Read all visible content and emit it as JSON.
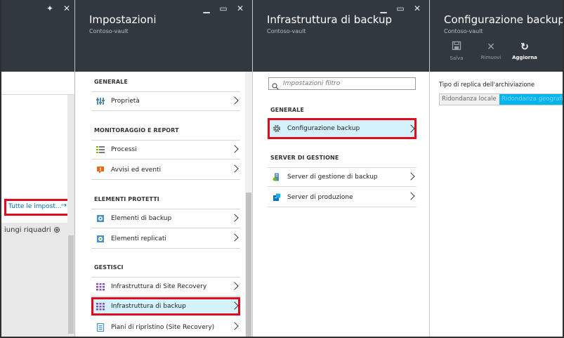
{
  "panel1": {
    "link_text": "Tutte le impost...",
    "arrow": "→",
    "add_tiles_text": "iungi riquadri",
    "add_icon": "⊕"
  },
  "panel2": {
    "title": "Impostazioni",
    "subtitle": "Contoso-vault",
    "sections": {
      "generale": "GENERALE",
      "monitoraggio": "MONITORAGGIO E REPORT",
      "elementi": "ELEMENTI PROTETTI",
      "gestisci": "GESTISCI"
    },
    "items": {
      "proprieta": "Proprietà",
      "processi": "Processi",
      "avvisi": "Avvisi ed eventi",
      "elementi_backup": "Elementi di backup",
      "elementi_replicati": "Elementi replicati",
      "infra_sr": "Infrastruttura di Site Recovery",
      "infra_backup": "Infrastruttura di backup",
      "piani": "Piani di ripristino (Site Recovery)"
    }
  },
  "panel3": {
    "title": "Infrastruttura di backup",
    "subtitle": "Contoso-vault",
    "filter_placeholder": "Impostazioni filtro",
    "sections": {
      "generale": "GENERALE",
      "server": "SERVER DI GESTIONE"
    },
    "items": {
      "config": "Configurazione backup",
      "server_backup": "Server di gestione di backup",
      "server_prod": "Server di produzione"
    }
  },
  "panel4": {
    "title": "Configurazione backup",
    "subtitle": "Contoso-vault",
    "toolbar": {
      "save": "Salva",
      "remove": "Rimuovi",
      "refresh": "Aggiorna"
    },
    "replica_label": "Tipo di replica dell'archiviazione",
    "options": [
      "Ridondanza locale",
      "Ridondanza geografica"
    ]
  },
  "colors": {
    "header": "#32383f",
    "highlight": "#e00b1c",
    "selected": "#d3f2fb",
    "accent": "#00b4f0",
    "link": "#0072c6"
  }
}
